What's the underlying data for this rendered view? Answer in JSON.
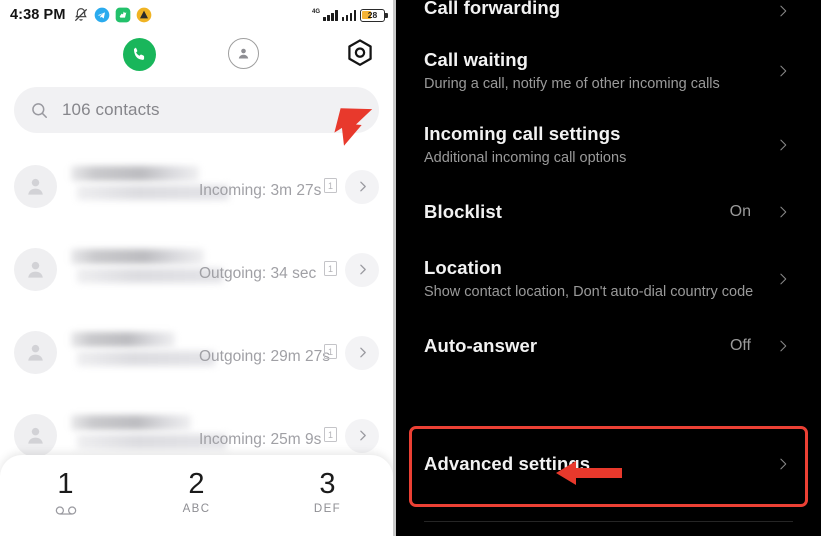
{
  "statusbar": {
    "time": "4:38 PM",
    "left_icons": [
      "bell-muted-icon",
      "telegram-icon",
      "green-app-icon",
      "orange-app-icon"
    ],
    "network_label": "4G",
    "battery_percent": "28"
  },
  "left_panel": {
    "tabs": [
      {
        "name": "phone-tab",
        "icon": "phone-icon"
      },
      {
        "name": "contacts-tab",
        "icon": "person-icon"
      },
      {
        "name": "settings-tab",
        "icon": "gear-hexagon-icon"
      }
    ],
    "search": {
      "icon": "search-icon",
      "text": "106 contacts"
    },
    "calls": [
      {
        "info": "Incoming: 3m 27s",
        "sim": "1"
      },
      {
        "info": "Outgoing: 34 sec",
        "sim": "1"
      },
      {
        "info": "Outgoing: 29m 27s",
        "sim": "1"
      },
      {
        "info": "Incoming: 25m 9s",
        "sim": "1"
      }
    ],
    "dialpad": [
      {
        "num": "1",
        "sub": "",
        "icon": "voicemail-icon"
      },
      {
        "num": "2",
        "sub": "ABC",
        "icon": ""
      },
      {
        "num": "3",
        "sub": "DEF",
        "icon": ""
      }
    ]
  },
  "right_panel": {
    "items": [
      {
        "title": "Call forwarding",
        "sub": "",
        "value": ""
      },
      {
        "title": "Call waiting",
        "sub": "During a call, notify me of other incoming calls",
        "value": ""
      },
      {
        "title": "Incoming call settings",
        "sub": "Additional incoming call options",
        "value": ""
      },
      {
        "title": "Blocklist",
        "sub": "",
        "value": "On"
      },
      {
        "title": "Location",
        "sub": "Show contact location, Don't auto-dial country code",
        "value": ""
      },
      {
        "title": "Auto-answer",
        "sub": "",
        "value": "Off"
      },
      {
        "title": "Advanced settings",
        "sub": "",
        "value": ""
      }
    ]
  },
  "annotations": {
    "highlight_color": "#eb4034",
    "arrow_gear": "red-arrow-up-icon",
    "arrow_advanced": "red-arrow-left-icon"
  }
}
